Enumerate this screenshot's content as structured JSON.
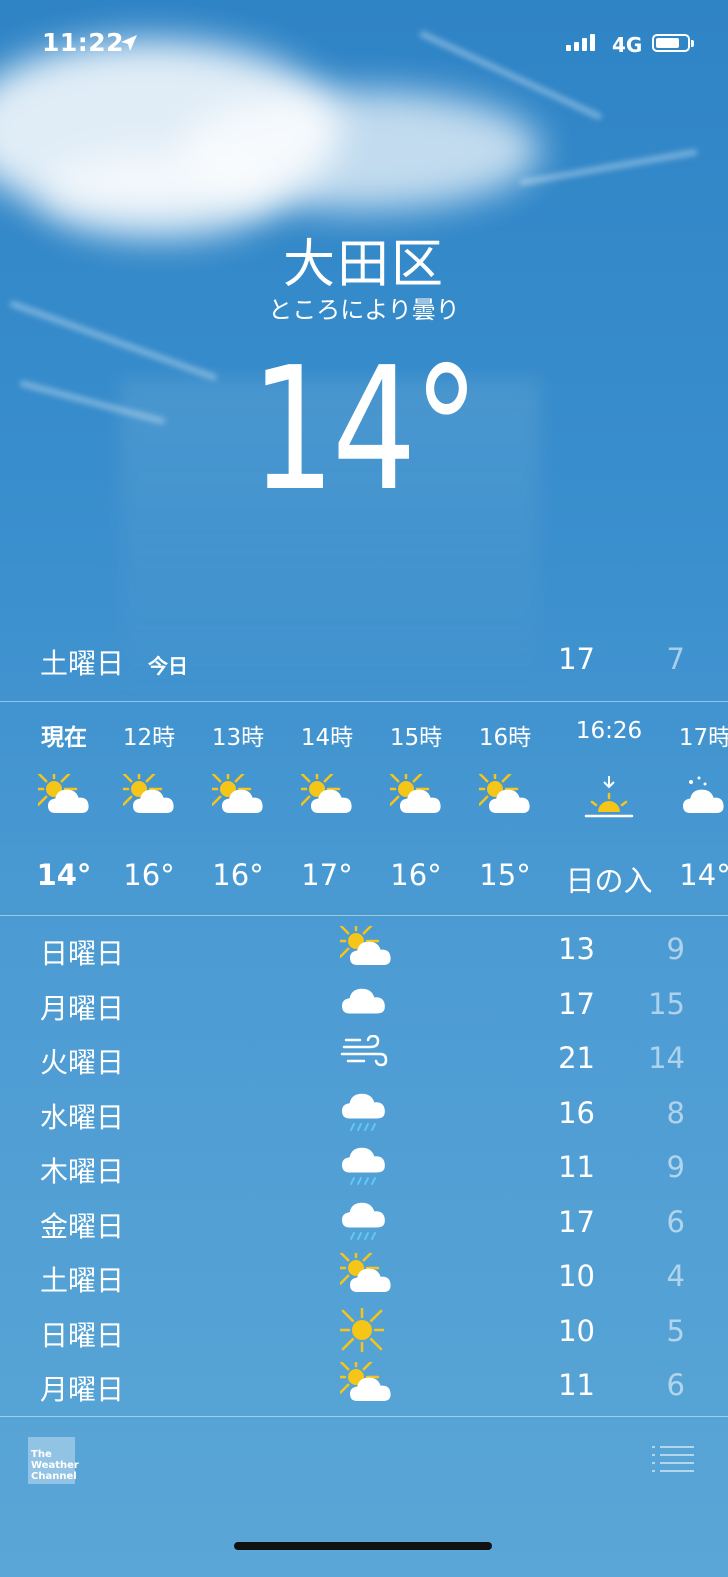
{
  "status_bar": {
    "time": "11:22",
    "network": "4G",
    "battery_level": 0.75,
    "signal_bars": 4
  },
  "location": {
    "city": "大田区",
    "condition": "ところにより曇り",
    "temperature": "14°"
  },
  "today": {
    "day": "土曜日",
    "label": "今日",
    "high": "17",
    "low": "7"
  },
  "hourly": [
    {
      "label": "現在",
      "icon": "partly-sunny-icon",
      "temp": "14°",
      "bold": true
    },
    {
      "label": "12時",
      "icon": "partly-sunny-icon",
      "temp": "16°"
    },
    {
      "label": "13時",
      "icon": "partly-sunny-icon",
      "temp": "16°"
    },
    {
      "label": "14時",
      "icon": "partly-sunny-icon",
      "temp": "17°"
    },
    {
      "label": "15時",
      "icon": "partly-sunny-icon",
      "temp": "16°"
    },
    {
      "label": "16時",
      "icon": "partly-sunny-icon",
      "temp": "15°"
    },
    {
      "label": "16:26",
      "icon": "sunset-icon",
      "temp": "日の入"
    },
    {
      "label": "17時",
      "icon": "partly-cloudy-night-icon",
      "temp": "14°"
    }
  ],
  "daily": [
    {
      "day": "日曜日",
      "icon": "partly-sunny-icon",
      "high": "13",
      "low": "9"
    },
    {
      "day": "月曜日",
      "icon": "cloud-icon",
      "high": "17",
      "low": "15"
    },
    {
      "day": "火曜日",
      "icon": "wind-icon",
      "high": "21",
      "low": "14"
    },
    {
      "day": "水曜日",
      "icon": "rain-icon",
      "high": "16",
      "low": "8"
    },
    {
      "day": "木曜日",
      "icon": "rain-icon",
      "high": "11",
      "low": "9"
    },
    {
      "day": "金曜日",
      "icon": "rain-icon",
      "high": "17",
      "low": "6"
    },
    {
      "day": "土曜日",
      "icon": "partly-sunny-icon",
      "high": "10",
      "low": "4"
    },
    {
      "day": "日曜日",
      "icon": "sun-icon",
      "high": "10",
      "low": "5"
    },
    {
      "day": "月曜日",
      "icon": "partly-sunny-icon",
      "high": "11",
      "low": "6"
    }
  ],
  "footer": {
    "logo_text": "The Weather Channel",
    "list_icon": "list-icon"
  },
  "colors": {
    "sun": "#f5c518",
    "cloud": "#ffffff",
    "rain": "#5fc8f5",
    "sky_top": "#2f84c6",
    "sky_bottom": "#5aa6d6"
  }
}
